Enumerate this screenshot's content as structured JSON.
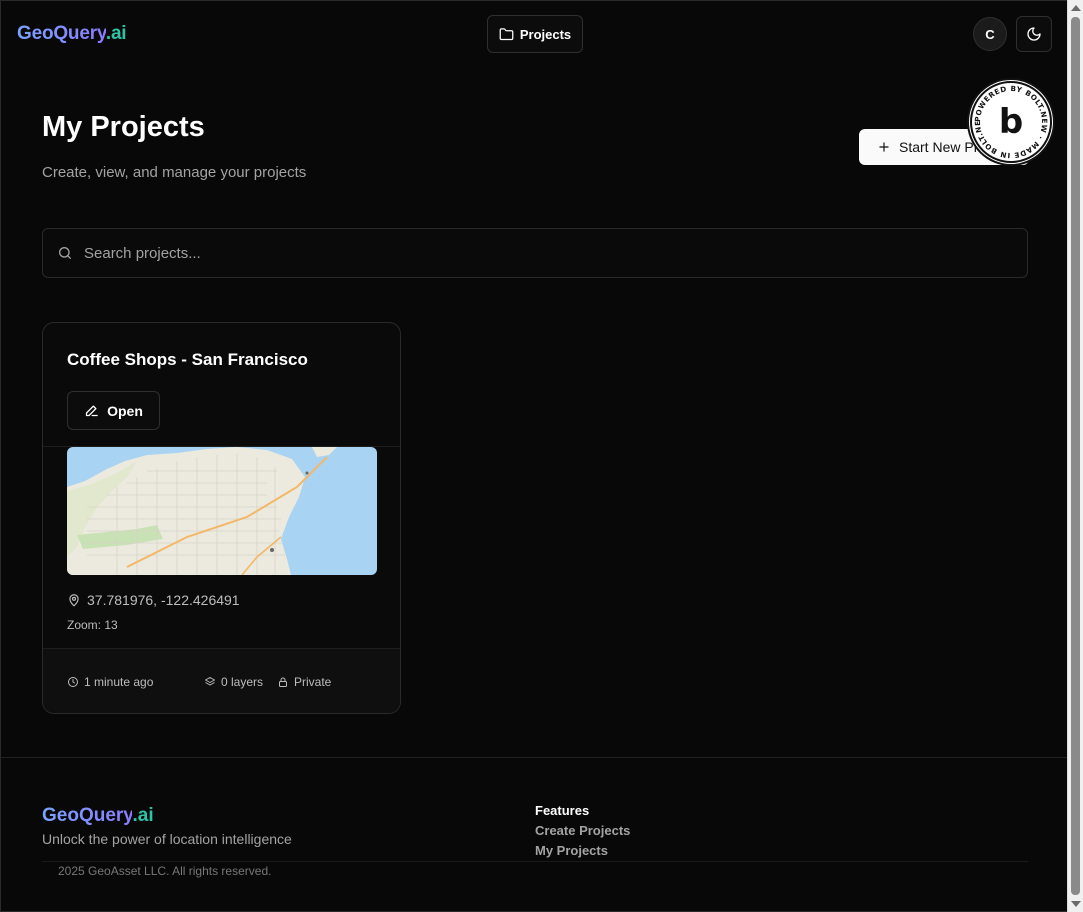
{
  "header": {
    "brand_main": "GeoQuery",
    "brand_suffix": ".ai",
    "nav_projects": "Projects",
    "avatar_initial": "C"
  },
  "badge": {
    "text": "POWERED BY BOLT.NEW · MADE IN BOLT.NEW ·",
    "logo_letter": "b"
  },
  "page": {
    "title": "My Projects",
    "subtitle": "Create, view, and manage your projects",
    "new_project_label": "Start New Project"
  },
  "search": {
    "placeholder": "Search projects..."
  },
  "projects": [
    {
      "title": "Coffee Shops - San Francisco",
      "open_label": "Open",
      "coordinates": "37.781976, -122.426491",
      "zoom": "Zoom: 13",
      "updated": "1 minute ago",
      "layers": "0 layers",
      "visibility": "Private"
    }
  ],
  "footer": {
    "brand_main": "GeoQuery",
    "brand_suffix": ".ai",
    "tagline": "Unlock the power of location intelligence",
    "features_title": "Features",
    "links": [
      "Create Projects",
      "My Projects"
    ],
    "copyright": "2025 GeoAsset LLC. All rights reserved."
  },
  "colors": {
    "background": "#080808",
    "brand_gradient_start": "#7aa2ff",
    "brand_suffix": "#2cc3a6",
    "muted_text": "#a3a3a3"
  },
  "icons": {
    "nav": "folder-icon",
    "theme": "moon-icon",
    "new": "plus-icon",
    "search": "search-icon",
    "open": "pencil-icon",
    "location": "map-pin-icon",
    "time": "clock-icon",
    "layers": "layers-icon",
    "privacy": "lock-icon"
  }
}
